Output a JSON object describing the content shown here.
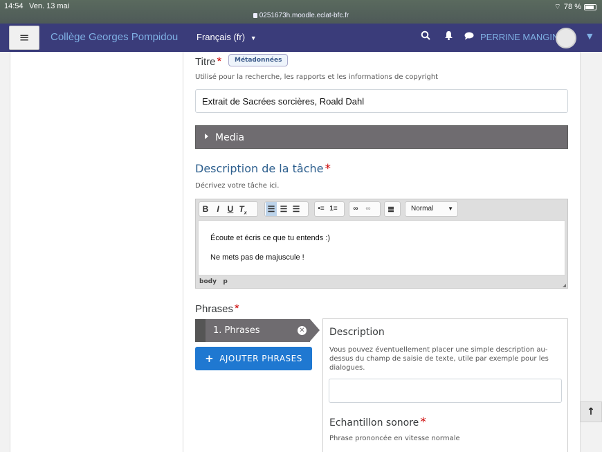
{
  "status_bar": {
    "time": "14:54",
    "date": "Ven. 13 mai",
    "url": "0251673h.moodle.eclat-bfc.fr",
    "battery": "78 %"
  },
  "navbar": {
    "menu_icon": "hamburger-icon",
    "brand": "Collège Georges Pompidou",
    "language": "Français (fr)",
    "user_name": "PERRINE MANGIN"
  },
  "form": {
    "title_label": "Titre",
    "title_badge": "Métadonnées",
    "title_help": "Utilisé pour la recherche, les rapports et les informations de copyright",
    "title_value": "Extrait de Sacrées sorcières, Roald Dahl",
    "media_label": "Media",
    "task_heading": "Description de la tâche",
    "task_help": "Décrivez votre tâche ici.",
    "editor": {
      "style_select": "Normal",
      "line1": "Écoute et écris ce que tu entends :)",
      "line2": "Ne mets pas de majuscule !",
      "path_body": "body",
      "path_p": "p"
    },
    "phrases_label": "Phrases",
    "phrase_tab": "1. Phrases",
    "add_button": "AJOUTER PHRASES",
    "panel": {
      "description_title": "Description",
      "description_help": "Vous pouvez éventuellement placer une simple description au-dessus du champ de saisie de texte, utile par exemple pour les dialogues.",
      "description_value": "",
      "audio_title": "Echantillon sonore",
      "audio_help": "Phrase prononcée en vitesse normale"
    }
  }
}
